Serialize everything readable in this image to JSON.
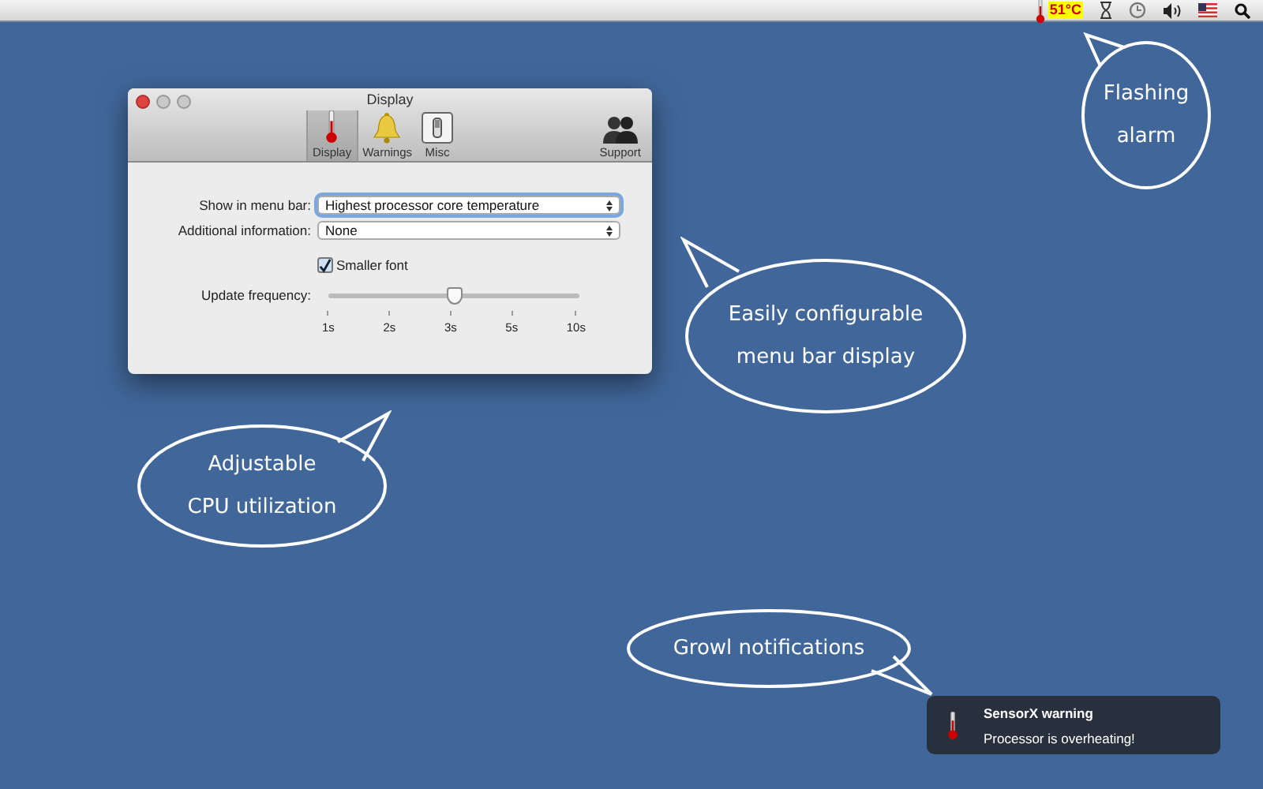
{
  "menu_bar": {
    "temperature": "51°C"
  },
  "window": {
    "title": "Display",
    "toolbar": [
      {
        "label": "Display",
        "kind": "thermometer",
        "selected": true
      },
      {
        "label": "Warnings",
        "kind": "bell",
        "selected": false
      },
      {
        "label": "Misc",
        "kind": "switch",
        "selected": false
      },
      {
        "label": "Support",
        "kind": "people",
        "selected": false
      }
    ],
    "popups": [
      {
        "label": "Show in menu bar:",
        "value": "Highest processor core temperature",
        "focused": true
      },
      {
        "label": "Additional information:",
        "value": "None",
        "focused": false
      }
    ],
    "checkbox": {
      "label": "Smaller font",
      "checked": true
    },
    "slider": {
      "label": "Update frequency:",
      "level": 0.5,
      "ticks": [
        "1s",
        "2s",
        "3s",
        "5s",
        "10s"
      ]
    }
  },
  "bubbles": [
    {
      "text": "Flashing alarm"
    },
    {
      "text": "Easily configurable menu bar display"
    },
    {
      "text": "Adjustable CPU utilization"
    },
    {
      "text": "Growl notifications"
    }
  ],
  "notification": {
    "title": "SensorX warning",
    "message": "Processor is overheating!"
  }
}
